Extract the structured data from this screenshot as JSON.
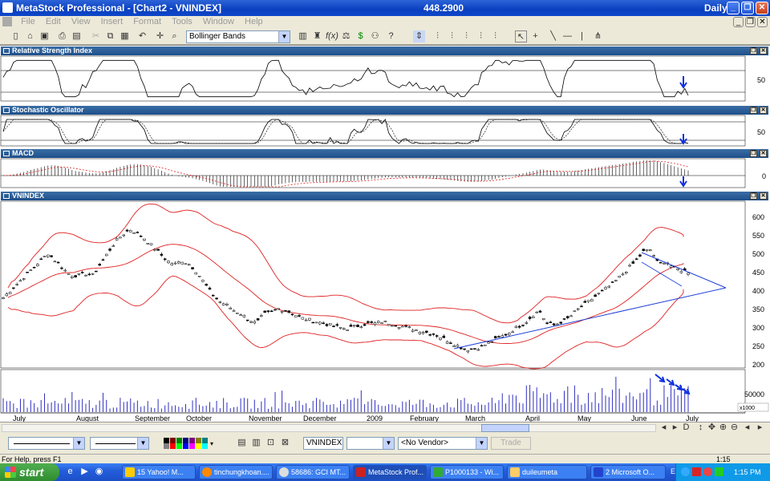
{
  "window": {
    "app_title": "MetaStock Professional - [Chart2 - VNINDEX]",
    "last_value": "448.2900",
    "period": "Daily"
  },
  "menu": [
    "File",
    "Edit",
    "View",
    "Insert",
    "Format",
    "Tools",
    "Window",
    "Help"
  ],
  "toolbar": {
    "indicator_select": "Bollinger Bands"
  },
  "panes": {
    "rsi": {
      "title": "Relative Strength Index",
      "tick": "50"
    },
    "stoch": {
      "title": "Stochastic Oscillator",
      "tick": "50"
    },
    "macd": {
      "title": "MACD",
      "tick": "0"
    },
    "price": {
      "title": "VNINDEX",
      "ticks": [
        "600",
        "550",
        "500",
        "450",
        "400",
        "350",
        "300",
        "250",
        "200"
      ]
    },
    "volume": {
      "tick": "50000",
      "scale": "x1000"
    }
  },
  "chart_data": {
    "type": "candlestick",
    "symbol": "VNINDEX",
    "x_labels": [
      "July",
      "August",
      "September",
      "October",
      "November",
      "December",
      "2009",
      "February",
      "March",
      "April",
      "May",
      "June",
      "July"
    ],
    "price_ylim": [
      200,
      600
    ],
    "price_closes": [
      380,
      400,
      420,
      440,
      460,
      480,
      500,
      480,
      460,
      440,
      440,
      445,
      440,
      470,
      500,
      530,
      550,
      565,
      555,
      540,
      520,
      500,
      480,
      470,
      480,
      470,
      450,
      420,
      390,
      370,
      360,
      345,
      335,
      320,
      310,
      335,
      340,
      350,
      345,
      335,
      325,
      320,
      315,
      310,
      305,
      300,
      295,
      300,
      305,
      310,
      310,
      315,
      310,
      305,
      300,
      295,
      290,
      285,
      280,
      270,
      260,
      250,
      240,
      240,
      245,
      255,
      265,
      275,
      285,
      300,
      310,
      330,
      345,
      310,
      305,
      315,
      325,
      345,
      360,
      375,
      390,
      405,
      420,
      440,
      460,
      480,
      505,
      510,
      470,
      480,
      460,
      455,
      450
    ],
    "volume_ticks": [
      "50000"
    ],
    "indicators": [
      "Relative Strength Index",
      "Stochastic Oscillator",
      "MACD",
      "Bollinger Bands"
    ]
  },
  "bottom": {
    "symbol_box": "VNINDEX",
    "vendor_box": "<No Vendor>",
    "trade_button": "Trade"
  },
  "status": {
    "help": "For Help, press F1",
    "time": "1:15"
  },
  "taskbar": {
    "start": "start",
    "tasks": [
      "15 Yahoo! M...",
      "tinchungkhoan....",
      "58686: GCI MT...",
      "MetaStock Prof...",
      "P1000133 - Wi...",
      "duileumeta",
      "2 Microsoft O..."
    ],
    "lang": "EN",
    "clock": "1:15 PM"
  },
  "colors": {
    "title_blue": "#0a3fbf",
    "pane_title": "#1e4f8a",
    "price_bar": "#000000",
    "bands": "#e02020",
    "trend": "#1f3fd8",
    "volume": "#3030c0"
  }
}
